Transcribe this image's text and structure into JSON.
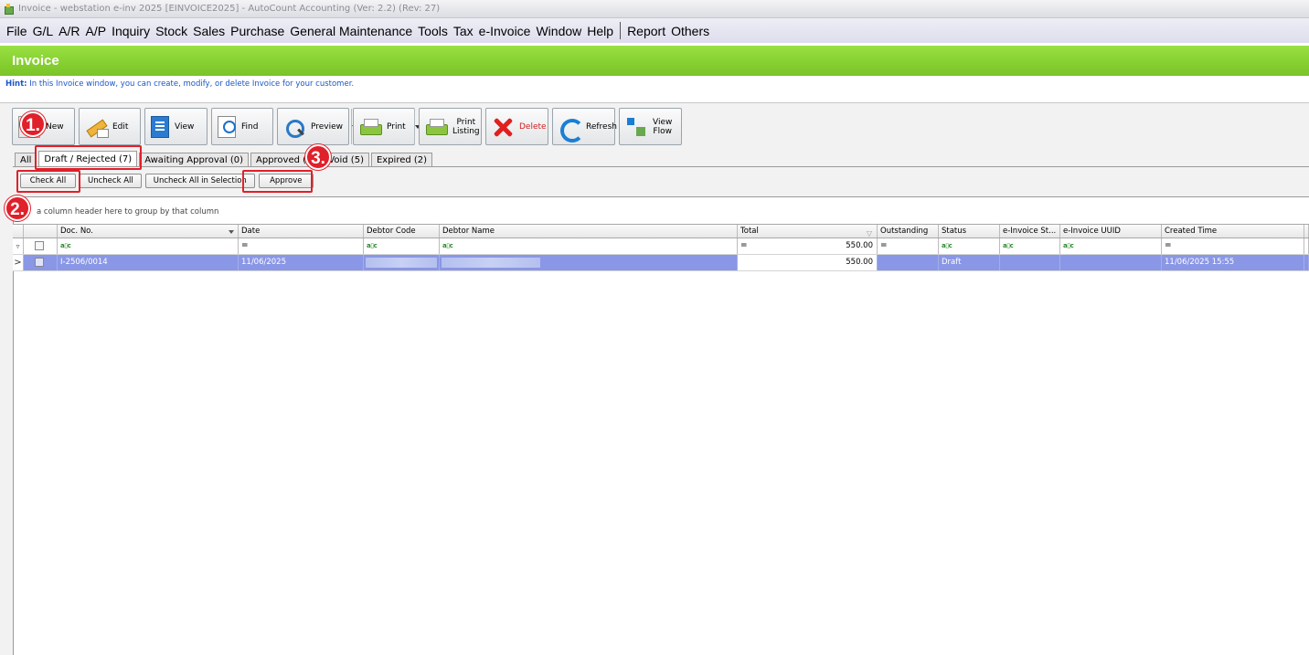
{
  "window": {
    "title": "Invoice - webstation e-inv 2025 [EINVOICE2025] - AutoCount Accounting (Ver: 2.2) (Rev: 27)"
  },
  "menu": {
    "items": [
      "File",
      "G/L",
      "A/R",
      "A/P",
      "Inquiry",
      "Stock",
      "Sales",
      "Purchase",
      "General Maintenance",
      "Tools",
      "Tax",
      "e-Invoice",
      "Window",
      "Help"
    ],
    "extra": [
      "Report",
      "Others"
    ]
  },
  "banner": {
    "title": "Invoice"
  },
  "hint": {
    "label": "Hint:",
    "text": " In this Invoice window, you can create, modify, or delete Invoice for your customer."
  },
  "toolbar": {
    "new": "New",
    "edit": "Edit",
    "view": "View",
    "find": "Find",
    "preview": "Preview",
    "print": "Print",
    "print_listing": "Print\nListing",
    "delete": "Delete",
    "refresh": "Refresh",
    "view_flow": "View\nFlow"
  },
  "tabs": [
    "All",
    "Draft / Rejected (7)",
    "Awaiting Approval (0)",
    "Approved (6)",
    "Void (5)",
    "Expired (2)"
  ],
  "actions": {
    "check_all": "Check All",
    "uncheck_all": "Uncheck All",
    "uncheck_selection": "Uncheck All in Selection",
    "approve": "Approve"
  },
  "group_hint": "a column header here to group by that column",
  "grid": {
    "columns": [
      "Doc. No.",
      "Date",
      "Debtor Code",
      "Debtor Name",
      "Total",
      "Outstanding",
      "Status",
      "e-Invoice St...",
      "e-Invoice UUID",
      "Created Time"
    ],
    "filter_total": "550.00",
    "rows": [
      {
        "doc_no": "I-2506/0014",
        "date": "11/06/2025",
        "total": "550.00",
        "status": "Draft",
        "created_time": "11/06/2025 15:55"
      }
    ]
  },
  "annotations": [
    "1.",
    "2.",
    "3."
  ],
  "colors": {
    "banner": "#86cf30",
    "selected_row": "#8a97e6",
    "annotation_red": "#e0202a",
    "hint_text": "#1b56c7"
  }
}
